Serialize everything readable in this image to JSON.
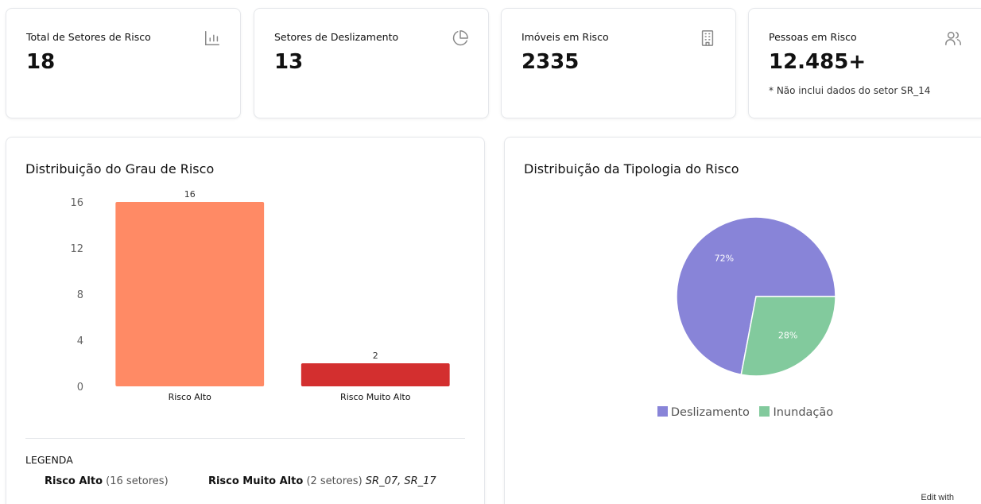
{
  "stats": [
    {
      "title": "Total de Setores de Risco",
      "value": "18",
      "icon": "bar-chart-icon"
    },
    {
      "title": "Setores de Deslizamento",
      "value": "13",
      "icon": "pie-chart-icon"
    },
    {
      "title": "Imóveis em Risco",
      "value": "2335",
      "icon": "building-icon"
    },
    {
      "title": "Pessoas em Risco",
      "value": "12.485+",
      "note": "* Não inclui dados do setor SR_14",
      "icon": "users-icon"
    }
  ],
  "bar_panel": {
    "title": "Distribuição do Grau de Risco",
    "legend_heading": "LEGENDA",
    "legend": [
      {
        "label": "Risco Alto",
        "count": "(16 setores)",
        "codes": ""
      },
      {
        "label": "Risco Muito Alto",
        "count": "(2 setores)",
        "codes": "SR_07, SR_17"
      }
    ]
  },
  "pie_panel": {
    "title": "Distribuição da Tipologia do Risco"
  },
  "footer": {
    "edit_with": "Edit with"
  },
  "chart_data": [
    {
      "type": "bar",
      "title": "Distribuição do Grau de Risco",
      "categories": [
        "Risco Alto",
        "Risco Muito Alto"
      ],
      "values": [
        16,
        2
      ],
      "colors": [
        "#ff8a65",
        "#d32f2f"
      ],
      "ylim": [
        0,
        16
      ],
      "yticks": [
        0,
        4,
        8,
        12,
        16
      ],
      "xlabel": "",
      "ylabel": ""
    },
    {
      "type": "pie",
      "title": "Distribuição da Tipologia do Risco",
      "labels": [
        "Deslizamento",
        "Inundação"
      ],
      "values": [
        72,
        28
      ],
      "value_labels": [
        "72%",
        "28%"
      ],
      "colors": [
        "#8884d8",
        "#82ca9d"
      ],
      "legend": "bottom"
    }
  ]
}
